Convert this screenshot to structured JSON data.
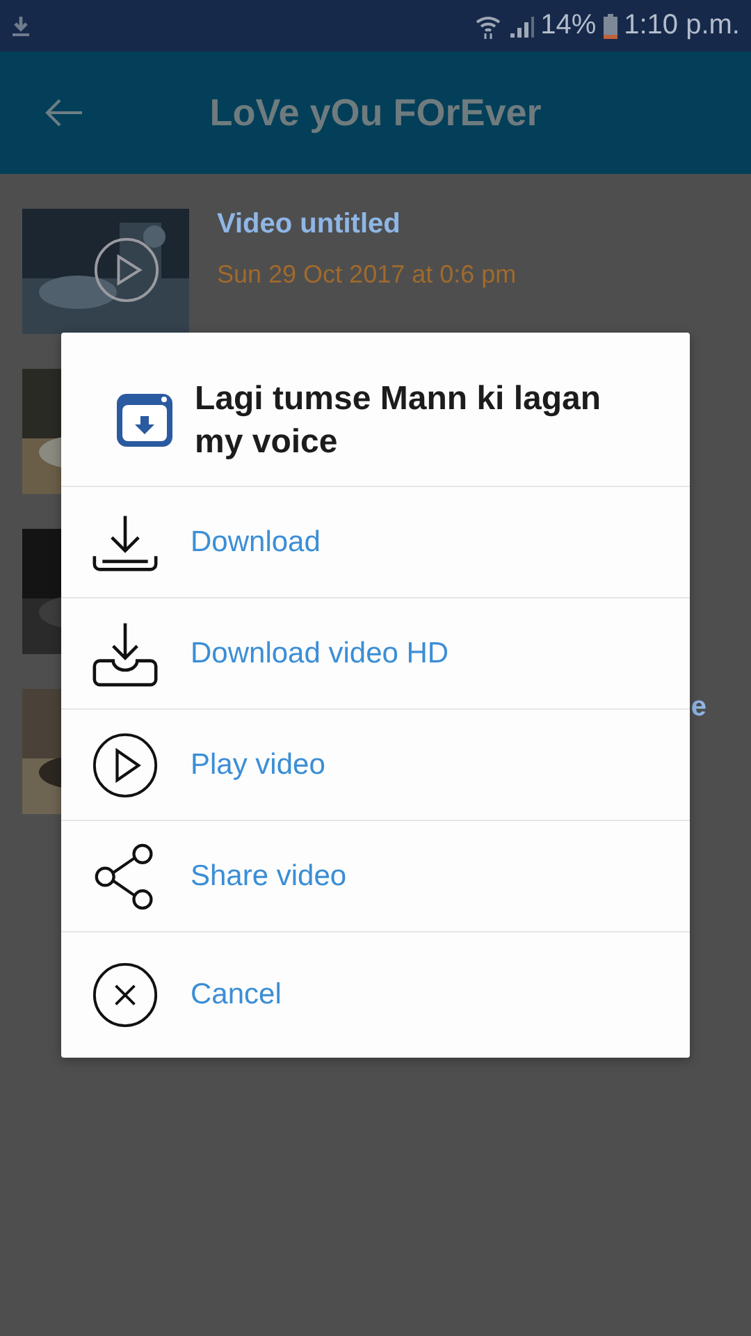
{
  "status_bar": {
    "battery": "14%",
    "time": "1:10 p.m."
  },
  "app_bar": {
    "title": "LoVe yOu FOrEver"
  },
  "videos": [
    {
      "kind": "picture",
      "title": "Video untitled",
      "date": "Sun 29 Oct 2017 at 0:6 pm"
    },
    {
      "kind": "picture"
    },
    {
      "kind": "picture"
    },
    {
      "kind": "picture",
      "title_end": "e"
    }
  ],
  "dialog": {
    "title": "Lagi tumse Mann ki lagan my voice",
    "actions": [
      {
        "kind": "download",
        "label": "Download"
      },
      {
        "kind": "download_hd",
        "label": "Download video HD"
      },
      {
        "kind": "play",
        "label": "Play video"
      },
      {
        "kind": "share",
        "label": "Share video"
      },
      {
        "kind": "cancel",
        "label": "Cancel"
      }
    ]
  }
}
